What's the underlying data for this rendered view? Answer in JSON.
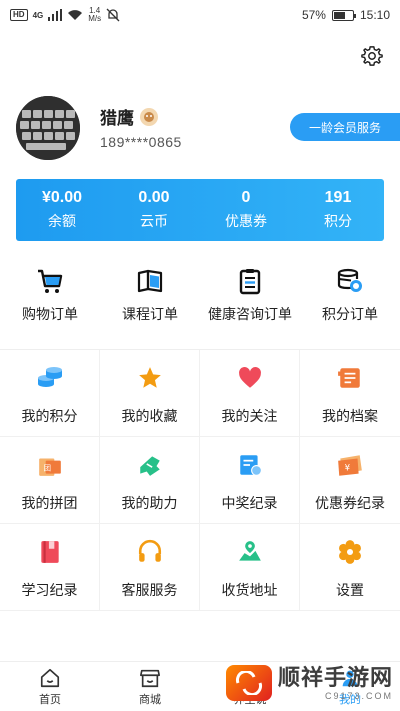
{
  "status_bar": {
    "network_badge": "HD",
    "signal_label": "4G",
    "speed_value": "1.4",
    "speed_unit": "M/s",
    "battery": "57%",
    "battery_level": 0.57,
    "time": "15:10"
  },
  "icons": {
    "settings": "gear-icon"
  },
  "profile": {
    "nickname": "猎鹰",
    "phone": "189****0865",
    "member_button": "一龄会员服务"
  },
  "stats": [
    {
      "value": "¥0.00",
      "label": "余额"
    },
    {
      "value": "0.00",
      "label": "云币"
    },
    {
      "value": "0",
      "label": "优惠券"
    },
    {
      "value": "191",
      "label": "积分"
    }
  ],
  "orders": [
    {
      "label": "购物订单",
      "icon": "cart-icon"
    },
    {
      "label": "课程订单",
      "icon": "book-icon"
    },
    {
      "label": "健康咨询订单",
      "icon": "clipboard-icon"
    },
    {
      "label": "积分订单",
      "icon": "coins-stack-icon"
    }
  ],
  "grid": [
    {
      "label": "我的积分",
      "icon": "coins-icon",
      "color": "#2a9df4"
    },
    {
      "label": "我的收藏",
      "icon": "star-icon",
      "color": "#f39c12"
    },
    {
      "label": "我的关注",
      "icon": "heart-icon",
      "color": "#ef4a5a"
    },
    {
      "label": "我的档案",
      "icon": "folder-icon",
      "color": "#f07a3a"
    },
    {
      "label": "我的拼团",
      "icon": "group-gift-icon",
      "color": "#f0a04b"
    },
    {
      "label": "我的助力",
      "icon": "boost-icon",
      "color": "#27c089"
    },
    {
      "label": "中奖纪录",
      "icon": "prize-record-icon",
      "color": "#2a9df4"
    },
    {
      "label": "优惠券纪录",
      "icon": "coupon-icon",
      "color": "#f07a3a"
    },
    {
      "label": "学习纪录",
      "icon": "study-book-icon",
      "color": "#ef4a5a"
    },
    {
      "label": "客服服务",
      "icon": "headset-icon",
      "color": "#f39c12"
    },
    {
      "label": "收货地址",
      "icon": "map-pin-icon",
      "color": "#27c089"
    },
    {
      "label": "设置",
      "icon": "settings-flower-icon",
      "color": "#f39c12"
    }
  ],
  "bottom_nav": [
    {
      "label": "首页",
      "icon": "home-icon",
      "active": false
    },
    {
      "label": "商城",
      "icon": "store-icon",
      "active": false
    },
    {
      "label": "养生说",
      "icon": "discover-icon",
      "active": false
    },
    {
      "label": "我的",
      "icon": "profile-icon",
      "active": true
    }
  ],
  "watermark": {
    "title": "顺祥手游网",
    "subtitle": "C9173.COM"
  }
}
